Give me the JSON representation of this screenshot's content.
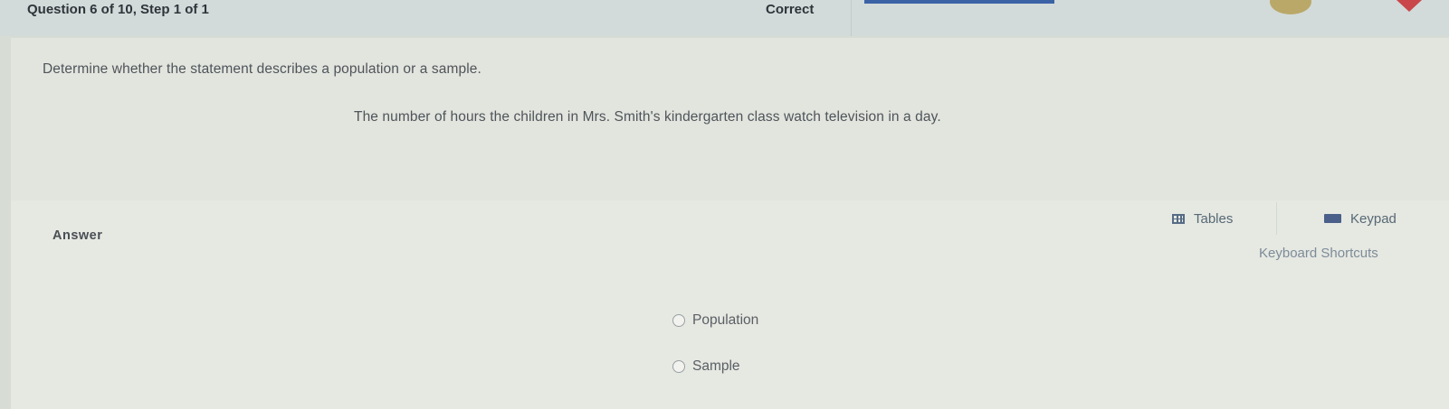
{
  "header": {
    "question_label": "Question 6 of 10, Step 1 of 1",
    "status": "Correct"
  },
  "prompt": {
    "instruction": "Determine whether the statement describes a population or a sample.",
    "statement": "The number of hours the children in Mrs. Smith's kindergarten class watch television in a day."
  },
  "answer": {
    "label": "Answer",
    "options": [
      {
        "label": "Population",
        "selected": false
      },
      {
        "label": "Sample",
        "selected": false
      }
    ]
  },
  "tools": {
    "tables_label": "Tables",
    "keypad_label": "Keypad",
    "shortcuts_label": "Keyboard Shortcuts"
  },
  "icons": {
    "tables": "table-icon",
    "keypad": "keypad-icon",
    "flag": "flag-icon"
  },
  "colors": {
    "progress": "#3c62a6",
    "flag": "#c9464a",
    "link": "#7d8c98"
  }
}
